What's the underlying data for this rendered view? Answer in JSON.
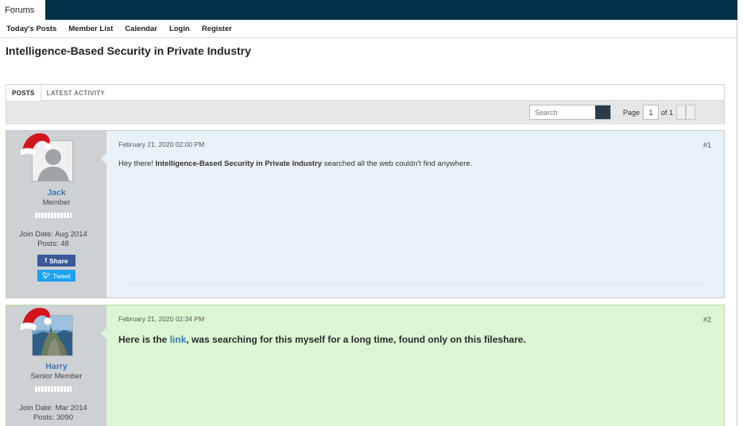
{
  "nav": {
    "forums_tab": "Forums",
    "links": [
      "Today's Posts",
      "Member List",
      "Calendar",
      "Login",
      "Register"
    ]
  },
  "thread": {
    "title": "Intelligence-Based Security in Private Industry"
  },
  "tabs": {
    "posts": "POSTS",
    "latest_activity": "LATEST ACTIVITY"
  },
  "toolbar": {
    "search_placeholder": "Search",
    "page_label": "Page",
    "page_value": "1",
    "of_label": "of 1"
  },
  "posts": [
    {
      "date": "February 21, 2020 02:00 PM",
      "number": "#1",
      "text_prefix": "Hey there! ",
      "text_bold": "Intelligence-Based Security in Private Industry",
      "text_suffix": " searched all the web couldn't find anywhere.",
      "user": {
        "name": "Jack",
        "title": "Member",
        "join_date": "Join Date: Aug 2014",
        "posts": "Posts: 48",
        "share_label": "Share",
        "tweet_label": "Tweet"
      }
    },
    {
      "date": "February 21, 2020 02:34 PM",
      "number": "#2",
      "text_prefix": "Here is the ",
      "link_text": "link",
      "text_suffix": ", was searching for this myself for a long time, found only on this fileshare.",
      "user": {
        "name": "Harry",
        "title": "Senior Member",
        "join_date": "Join Date: Mar 2014",
        "posts": "Posts: 3090"
      }
    }
  ],
  "colors": {
    "topbar": "#013249",
    "username": "#3a78b5",
    "post1_bg": "#e9f1f8",
    "post2_bg": "#dcf6d3",
    "facebook": "#3b5998",
    "twitter": "#1da1f2"
  }
}
